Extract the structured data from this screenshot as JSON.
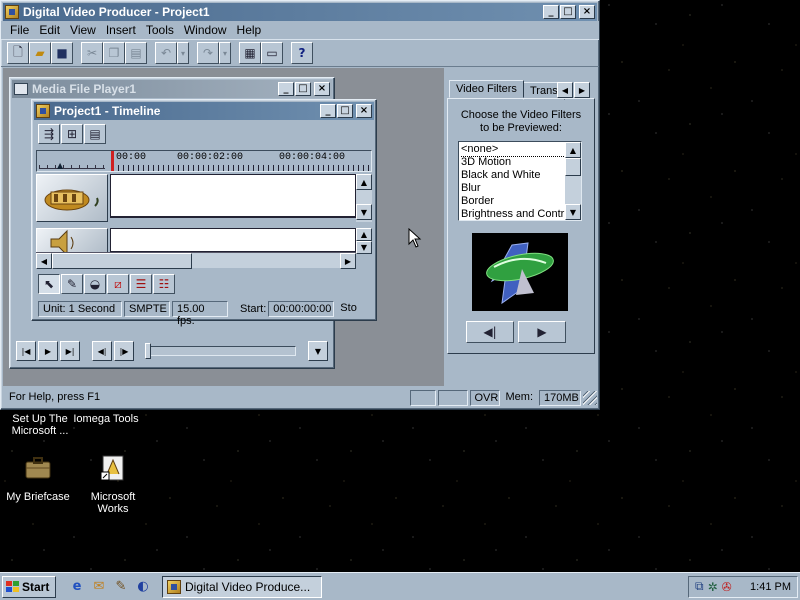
{
  "app": {
    "title": "Digital Video Producer - Project1",
    "menu": [
      "File",
      "Edit",
      "View",
      "Insert",
      "Tools",
      "Window",
      "Help"
    ],
    "status": {
      "help_text": "For Help, press F1",
      "ovr": "OVR",
      "mem_label": "Mem:",
      "mem_value": "170MB"
    }
  },
  "media_player": {
    "title": "Media File Player1"
  },
  "timeline": {
    "title": "Project1 - Timeline",
    "ruler": [
      "00:00",
      "00:00:02:00",
      "00:00:04:00"
    ],
    "status": {
      "unit": "Unit: 1 Second",
      "format": "SMPTE",
      "fps": "15.00 fps.",
      "start_label": "Start:",
      "start_value": "00:00:00:00",
      "stop_label": "Sto"
    }
  },
  "filters_panel": {
    "tabs": [
      "Video Filters",
      "Transi"
    ],
    "prompt_line1": "Choose the Video Filters",
    "prompt_line2": "to be Previewed:",
    "items": [
      "<none>",
      "3D Motion",
      "Black and White",
      "Blur",
      "Border",
      "Brightness and Contr"
    ]
  },
  "desktop_icons": [
    {
      "line1": "Set Up The",
      "line2": "Microsoft ..."
    },
    {
      "line1": "Iomega Tools",
      "line2": ""
    },
    {
      "line1": "My Briefcase",
      "line2": ""
    },
    {
      "line1": "Microsoft",
      "line2": "Works"
    }
  ],
  "taskbar": {
    "start_label": "Start",
    "task_label": "Digital Video Produce...",
    "clock": "1:41 PM"
  }
}
